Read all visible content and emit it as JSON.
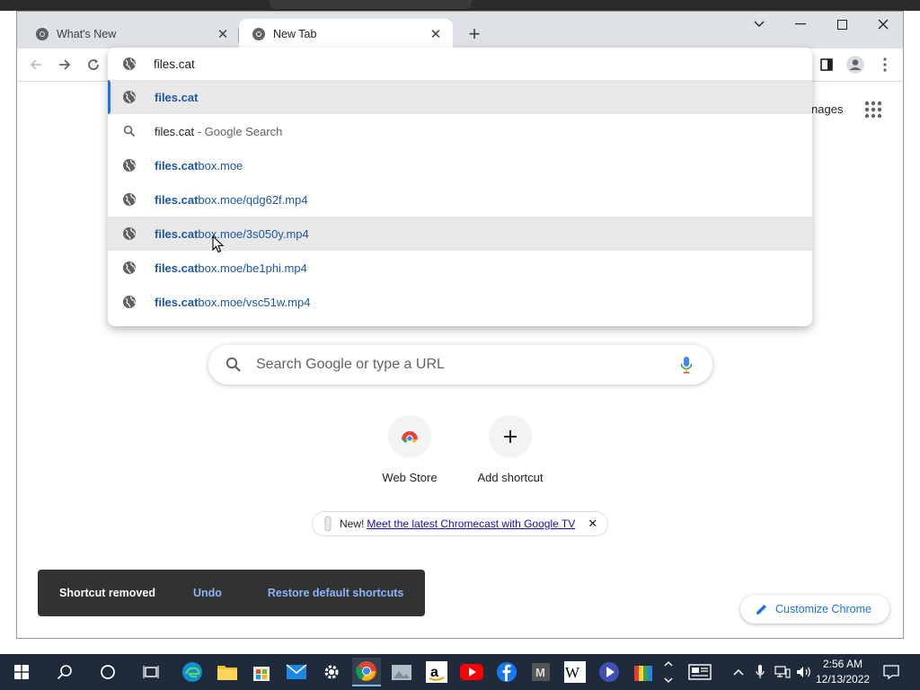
{
  "browser": {
    "tabs": [
      {
        "title": "What's New",
        "active": false
      },
      {
        "title": "New Tab",
        "active": true
      }
    ]
  },
  "omnibox": {
    "input_value": "files.cat",
    "suggestions": [
      {
        "type": "url",
        "bold": "files.cat",
        "rest": "",
        "selected": true
      },
      {
        "type": "search",
        "query": "files.cat",
        "suffix": "Google Search"
      },
      {
        "type": "url",
        "bold": "files.cat",
        "rest": "box.moe"
      },
      {
        "type": "url",
        "bold": "files.cat",
        "rest": "box.moe/qdg62f.mp4"
      },
      {
        "type": "url",
        "bold": "files.cat",
        "rest": "box.moe/3s050y.mp4",
        "hovered": true
      },
      {
        "type": "url",
        "bold": "files.cat",
        "rest": "box.moe/be1phi.mp4"
      },
      {
        "type": "url",
        "bold": "files.cat",
        "rest": "box.moe/vsc51w.mp4"
      }
    ]
  },
  "ntp": {
    "images_link": "nages",
    "search_placeholder": "Search Google or type a URL",
    "shortcuts": [
      {
        "label": "Web Store"
      },
      {
        "label": "Add shortcut"
      }
    ],
    "promo": {
      "prefix": "New!",
      "link": "Meet the latest Chromecast with Google TV"
    },
    "toast": {
      "message": "Shortcut removed",
      "undo": "Undo",
      "restore": "Restore default shortcuts"
    },
    "customize_label": "Customize Chrome"
  },
  "taskbar": {
    "time": "2:56 AM",
    "date": "12/13/2022"
  },
  "colors": {
    "accent": "#1a73e8",
    "url_text": "#1a57a8",
    "taskbar": "#1f2b3a",
    "toast": "#323232"
  }
}
